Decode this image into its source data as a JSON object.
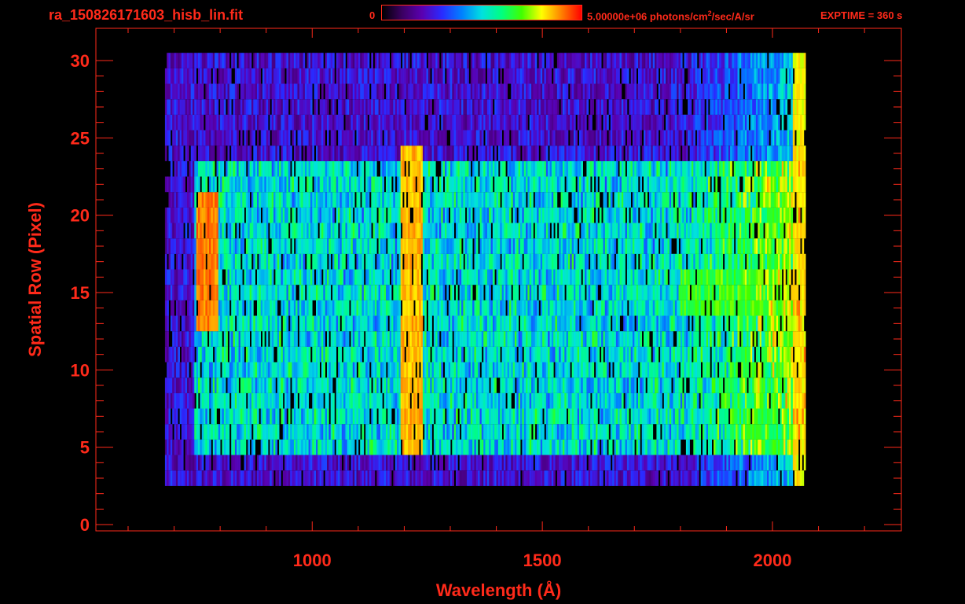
{
  "header": {
    "filename": "ra_150826171603_hisb_lin.fit",
    "colorbar_min": "0",
    "colorbar_max_prefix": "5.00000e+06 photons/cm",
    "colorbar_max_sup": "2",
    "colorbar_max_suffix": "/sec/A/sr",
    "exposure": "EXPTIME = 360 s"
  },
  "colors": {
    "axis": "#ff2a1a",
    "background": "#000000",
    "colormap": [
      "#000000",
      "#3a0060",
      "#5a00b0",
      "#2a2aff",
      "#0080ff",
      "#00e0e0",
      "#00ff80",
      "#40ff00",
      "#ffff00",
      "#ff8000",
      "#ff0000"
    ]
  },
  "chart_data": {
    "type": "heatmap",
    "title": "ra_150826171603_hisb_lin.fit",
    "xlabel": "Wavelength (Å)",
    "ylabel": "Spatial Row (Pixel)",
    "xlim": [
      530,
      2280
    ],
    "ylim": [
      0,
      30
    ],
    "xticks": [
      1000,
      1500,
      2000
    ],
    "xtick_labels": [
      "1000",
      "1500",
      "2000"
    ],
    "yticks": [
      0,
      5,
      10,
      15,
      20,
      25,
      30
    ],
    "ytick_labels": [
      "0",
      "5",
      "10",
      "15",
      "20",
      "25",
      "30"
    ],
    "colorbar": {
      "min": 0,
      "max": 5000000,
      "units": "photons/cm^2/sec/A/sr"
    },
    "exptime_s": 360,
    "data_extent": {
      "x": [
        680,
        2070
      ],
      "rows_signal": [
        3,
        30
      ]
    },
    "features": [
      {
        "name": "bright arc",
        "x": 770,
        "rows": [
          13,
          21
        ],
        "level": 0.95
      },
      {
        "name": "bright vertical line",
        "x": 1215,
        "rows": [
          5,
          24
        ],
        "level": 0.9
      },
      {
        "name": "horizontal band",
        "x": [
          1800,
          2060
        ],
        "rows": [
          14,
          16
        ],
        "level": 0.7
      },
      {
        "name": "right edge",
        "x": 2065,
        "rows": [
          1,
          30
        ],
        "level": 0.85
      }
    ]
  }
}
